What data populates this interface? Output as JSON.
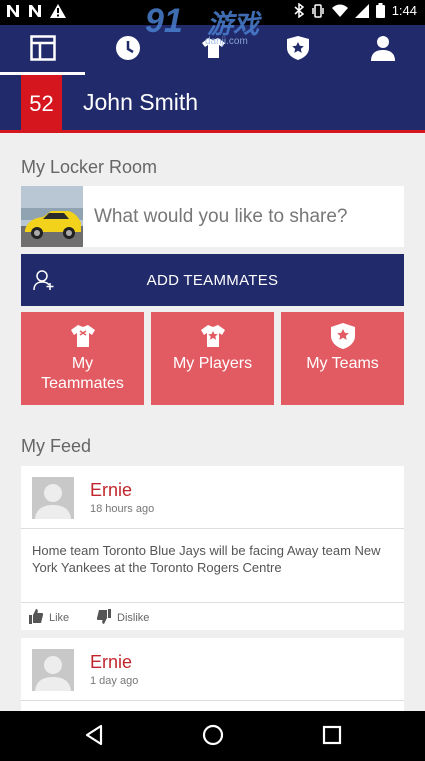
{
  "status_bar": {
    "time": "1:44"
  },
  "watermark": {
    "big": "91",
    "cn": "游戏",
    "url": "danji.com"
  },
  "nav_tabs": [
    {
      "name": "dashboard",
      "icon": "dashboard-icon"
    },
    {
      "name": "history",
      "icon": "clock-icon"
    },
    {
      "name": "jersey",
      "icon": "jersey-icon"
    },
    {
      "name": "teams",
      "icon": "shield-star-icon"
    },
    {
      "name": "profile",
      "icon": "person-icon"
    }
  ],
  "header": {
    "number": "52",
    "name": "John Smith"
  },
  "locker_room": {
    "title": "My Locker Room",
    "share_placeholder": "What would you like to share?",
    "add_teammates": "ADD TEAMMATES"
  },
  "tiles": [
    {
      "line1": "My",
      "line2": "Teammates"
    },
    {
      "line1": "My Players",
      "line2": ""
    },
    {
      "line1": "My Teams",
      "line2": ""
    }
  ],
  "feed": {
    "title": "My Feed",
    "posts": [
      {
        "author": "Ernie",
        "time": "18 hours ago",
        "body": "Home team Toronto Blue Jays will be facing Away team New York Yankees at the Toronto Rogers Centre",
        "like": "Like",
        "dislike": "Dislike"
      },
      {
        "author": "Ernie",
        "time": "1 day ago"
      }
    ]
  },
  "colors": {
    "navy": "#212a6b",
    "red": "#d6161e",
    "tile": "#e25b62"
  }
}
